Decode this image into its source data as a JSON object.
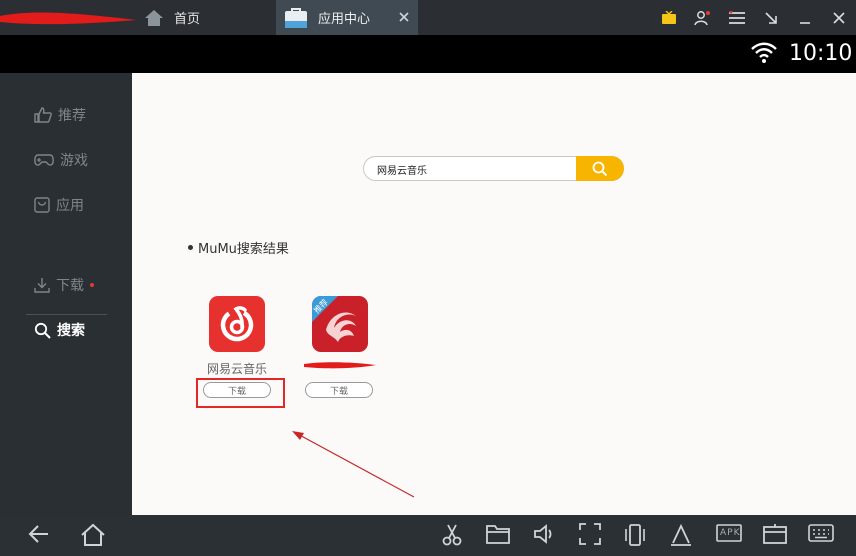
{
  "tabs": {
    "home_label": "首页",
    "app_center_label": "应用中心"
  },
  "status": {
    "time": "10:10"
  },
  "sidebar": {
    "items": [
      {
        "label": "推荐"
      },
      {
        "label": "游戏"
      },
      {
        "label": "应用"
      },
      {
        "label": "下载"
      },
      {
        "label": "搜索"
      }
    ]
  },
  "search": {
    "query": "网易云音乐"
  },
  "results": {
    "title": "MuMu搜索结果",
    "apps": [
      {
        "name": "网易云音乐",
        "download_label": "下载"
      },
      {
        "name": "",
        "badge": "推荐",
        "download_label": "下载"
      }
    ]
  },
  "colors": {
    "accent": "#f7b400",
    "highlight": "#e32626",
    "sidebar_bg": "#2a2f33",
    "netease_red": "#e6312f"
  },
  "watermark": "APK"
}
